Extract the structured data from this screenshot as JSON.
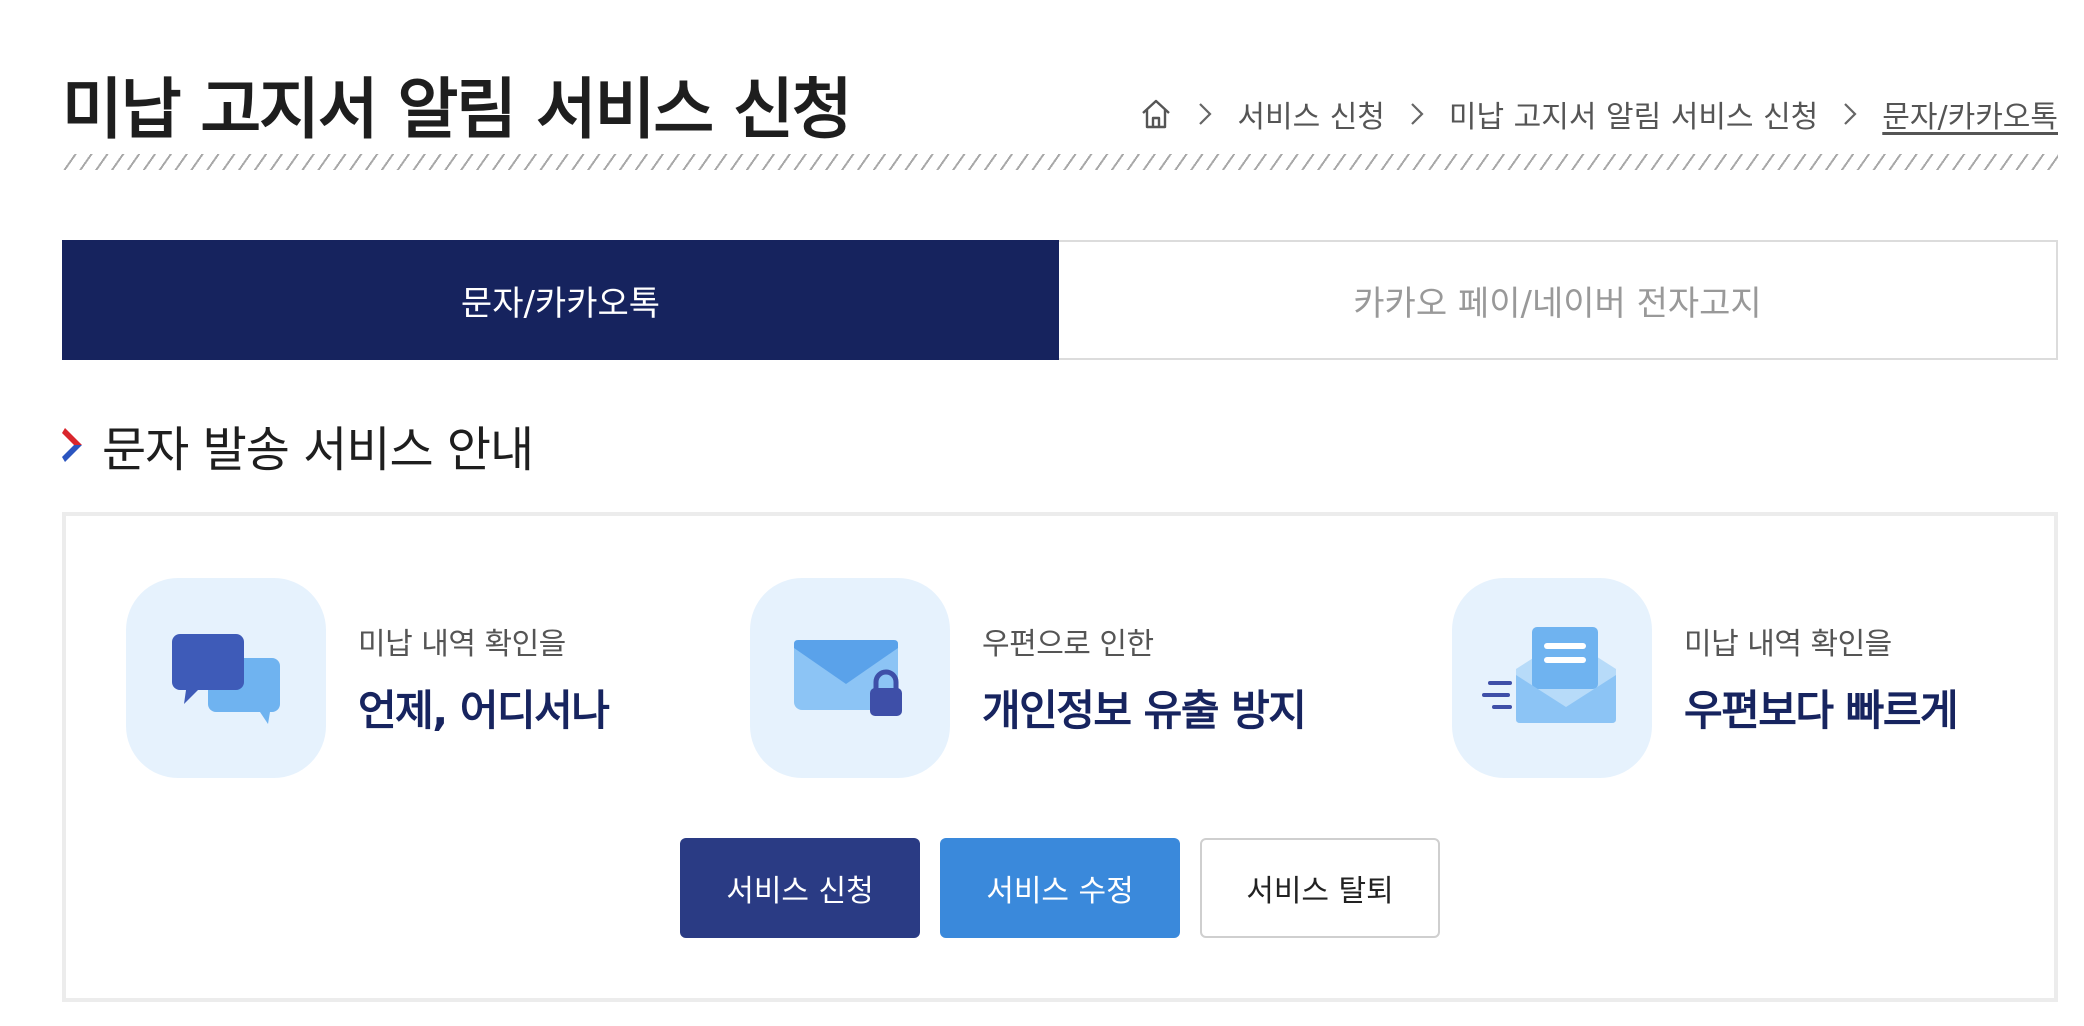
{
  "header": {
    "title": "미납 고지서 알림 서비스 신청"
  },
  "breadcrumb": {
    "items": [
      "서비스 신청",
      "미납 고지서 알림 서비스 신청"
    ],
    "current": "문자/카카오톡"
  },
  "tabs": [
    {
      "label": "문자/카카오톡",
      "active": true
    },
    {
      "label": "카카오 페이/네이버 전자고지",
      "active": false
    }
  ],
  "section": {
    "title": "문자 발송 서비스 안내"
  },
  "features": [
    {
      "icon": "chat-bubbles-icon",
      "sub": "미납 내역 확인을",
      "main": "언제, 어디서나"
    },
    {
      "icon": "mail-lock-icon",
      "sub": "우편으로 인한",
      "main": "개인정보 유출 방지"
    },
    {
      "icon": "fast-mail-icon",
      "sub": "미납 내역 확인을",
      "main": "우편보다 빠르게"
    }
  ],
  "buttons": {
    "apply": "서비스 신청",
    "modify": "서비스 수정",
    "withdraw": "서비스 탈퇴"
  },
  "colors": {
    "navy": "#16235e",
    "primary_button": "#2a3b84",
    "secondary_button": "#3a89db",
    "icon_bg": "#e6f2fd",
    "accent_red": "#d9262c"
  }
}
